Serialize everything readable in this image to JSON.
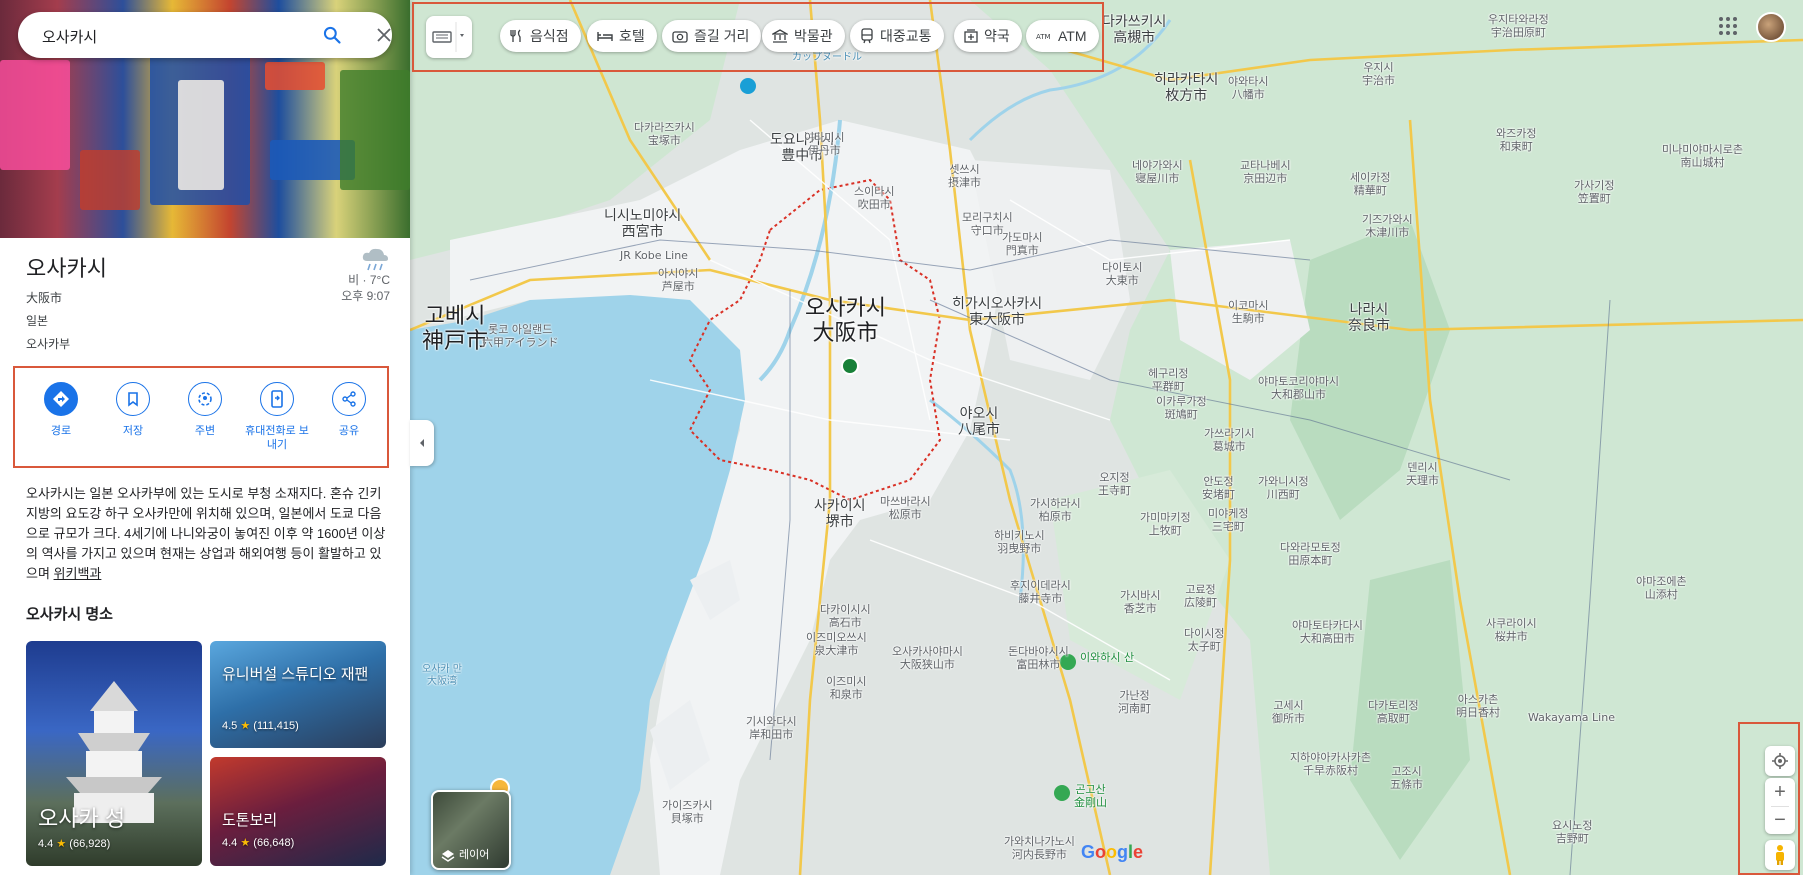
{
  "search": {
    "value": "오사카시"
  },
  "place": {
    "name": "오사카시",
    "local_name": "大阪市",
    "country": "일본",
    "region": "오사카부",
    "weather": {
      "condition": "비 · 7°C",
      "time": "오후 9:07"
    }
  },
  "actions": [
    {
      "label": "경로",
      "icon": "directions-icon"
    },
    {
      "label": "저장",
      "icon": "bookmark-icon"
    },
    {
      "label": "주변",
      "icon": "nearby-icon"
    },
    {
      "label": "휴대전화로 보내기",
      "icon": "send-to-phone-icon"
    },
    {
      "label": "공유",
      "icon": "share-icon"
    }
  ],
  "description": {
    "text": "오사카시는 일본 오사카부에 있는 도시로 부청 소재지다. 혼슈 긴키 지방의 요도강 하구 오사카만에 위치해 있으며, 일본에서 도쿄 다음으로 규모가 크다. 4세기에 나니와궁이 놓여진 이후 약 1600년 이상의 역사를 가지고 있으며 현재는 상업과 해외여행 등이 활발하고 있으며 ",
    "wiki_link": "위키백과"
  },
  "landmarks": {
    "title": "오사카시 명소",
    "items": [
      {
        "name": "오사카 성",
        "rating": "4.4",
        "reviews": "(66,928)"
      },
      {
        "name": "유니버설 스튜디오 재팬",
        "rating": "4.5",
        "reviews": "(111,415)"
      },
      {
        "name": "도톤보리",
        "rating": "4.4",
        "reviews": "(66,648)"
      }
    ]
  },
  "chips": [
    {
      "label": "음식점",
      "icon": "restaurant-icon"
    },
    {
      "label": "호텔",
      "icon": "hotel-icon"
    },
    {
      "label": "즐길 거리",
      "icon": "camera-icon"
    },
    {
      "label": "박물관",
      "icon": "museum-icon"
    },
    {
      "label": "대중교통",
      "icon": "transit-icon"
    },
    {
      "label": "약국",
      "icon": "pharmacy-icon"
    },
    {
      "label": "ATM",
      "icon": "atm-icon"
    }
  ],
  "map_labels": {
    "osaka_ko": "오사카시",
    "osaka_ja": "大阪市",
    "kobe_ko": "고베시",
    "kobe_ja": "神戸市",
    "nishinomiya_ko": "니시노미야시",
    "nishinomiya_ja": "西宮市",
    "toyonaka_ko": "도요나카시",
    "toyonaka_ja": "豊中市",
    "takatsuki_ko": "다카쓰키시",
    "takatsuki_ja": "高槻市",
    "hirakata_ko": "히라카타시",
    "hirakata_ja": "枚方市",
    "higashiosaka_ko": "히가시오사카시",
    "higashiosaka_ja": "東大阪市",
    "yao_ko": "야오시",
    "yao_ja": "八尾市",
    "sakai_ko": "사카이시",
    "sakai_ja": "堺市",
    "nara_ko": "나라시",
    "nara_ja": "奈良市",
    "takarazuka_ko": "다카라즈카시",
    "takarazuka_ja": "宝塚市",
    "itami_ko": "이타미시",
    "itami_ja": "伊丹市",
    "ashiya_ko": "아시야시",
    "ashiya_ja": "芦屋市",
    "rokko_ko": "롯코 아일랜드",
    "rokko_ja": "六甲アイランド",
    "suita_ko": "스이타시",
    "suita_ja": "吹田市",
    "settsu_ko": "셋쓰시",
    "settsu_ja": "摂津市",
    "moriguchi_ko": "모리구치시",
    "moriguchi_ja": "守口市",
    "kadoma_ko": "가도마시",
    "kadoma_ja": "門真市",
    "daito_ko": "다이토시",
    "daito_ja": "大東市",
    "neyagawa_ko": "네야가와시",
    "neyagawa_ja": "寝屋川市",
    "ikoma_ko": "이코마시",
    "ikoma_ja": "生駒市",
    "yamatokoriyama_ko": "야마토코리야마시",
    "yamatokoriyama_ja": "大和郡山市",
    "kashihara_ko": "가시하라시",
    "kashihara_ja": "柏原市",
    "habikino_ko": "하비키노시",
    "habikino_ja": "羽曳野市",
    "matsubara_ko": "마쓰바라시",
    "matsubara_ja": "松原市",
    "takaishi_ko": "다카이시시",
    "takaishi_ja": "高石市",
    "izumiotsu_ko": "이즈미오쓰시",
    "izumiotsu_ja": "泉大津市",
    "izumi_ko": "이즈미시",
    "izumi_ja": "和泉市",
    "kishiwada_ko": "기시와다시",
    "kishiwada_ja": "岸和田市",
    "kaizuka_ko": "가이즈카시",
    "kaizuka_ja": "貝塚市",
    "tondabayashi_ko": "돈다바야시시",
    "tondabayashi_ja": "富田林市",
    "osakasayama_ko": "오사카사야마시",
    "osakasayama_ja": "大阪狭山市",
    "kawachinagano_ko": "가와치나가노시",
    "kawachinagano_ja": "河内長野市",
    "kashiba_ko": "가시바시",
    "kashiba_ja": "香芝市",
    "gojo_ko": "고조시",
    "gojo_ja": "五條市",
    "yoshino_ko": "요시노정",
    "yoshino_ja": "吉野町",
    "sakurai_ko": "사쿠라이시",
    "sakurai_ja": "桜井市",
    "tenri_ko": "덴리시",
    "tenri_ja": "天理市",
    "kizugawa_ko": "기즈가와시",
    "kizugawa_ja": "木津川市",
    "uji_ko": "우지시",
    "uji_ja": "宇治市",
    "ujitawara_ko": "우지타와라정",
    "ujitawara_ja": "宇治田原町",
    "kyotanabe_ko": "교타나베시",
    "kyotanabe_ja": "京田辺市",
    "yawata_ko": "야와타시",
    "yawata_ja": "八幡市",
    "minamiyamashiro_ko": "미나미야마시로촌",
    "minamiyamashiro_ja": "南山城村",
    "wazuka_ko": "와즈카정",
    "wazuka_ja": "和束町",
    "kasagi_ko": "가사기정",
    "kasagi_ja": "笠置町",
    "seika_ko": "세이카정",
    "seika_ja": "精華町",
    "ikaruga_ko": "이카루가정",
    "ikaruga_ja": "斑鳩町",
    "ando_ko": "안도정",
    "ando_ja": "安堵町",
    "tawaramoto_ko": "다와라모토정",
    "tawaramoto_ja": "田原本町",
    "kawanishi_ko": "가와니시정",
    "kawanishi_ja": "川西町",
    "miyake_ko": "미야케정",
    "miyake_ja": "三宅町",
    "kamimaki_ko": "가미마키정",
    "kamimaki_ja": "上牧町",
    "oji_ko": "오지정",
    "oji_ja": "王寺町",
    "koryo_ko": "고료정",
    "koryo_ja": "広陵町",
    "heguri_ko": "헤구리정",
    "heguri_ja": "平群町",
    "yamazoe_ko": "야마조에촌",
    "yamazoe_ja": "山添村",
    "asuka_ko": "아스카촌",
    "asuka_ja": "明日香村",
    "takatori_ko": "다카토리정",
    "takatori_ja": "高取町",
    "katsuragi_ko": "가쓰라기시",
    "katsuragi_ja": "葛城市",
    "gose_ko": "고세시",
    "gose_ja": "御所市",
    "yamatotakada_ko": "야마토타카다시",
    "yamatotakada_ja": "大和高田市",
    "fujiidera_ko": "후지이데라시",
    "fujiidera_ja": "藤井寺市",
    "kanan_ko": "가난정",
    "kanan_ja": "河南町",
    "taishi_ko": "다이시정",
    "taishi_ja": "太子町",
    "chihayaakasaka_ko": "지하야아카사카촌",
    "chihayaakasaka_ja": "千早赤阪村",
    "mt_iwahashi_ko": "이와하시 산",
    "mt_kongo_ko": "곤고산",
    "mt_kongo_ja": "金剛山",
    "osaka_bay_ko": "오사카 만",
    "osaka_bay_ja": "大阪湾",
    "cupnoodle": "カップヌードル",
    "jr_kobe_line": "JR Kobe Line",
    "wakayama_line": "Wakayama Line"
  },
  "map_controls": {
    "layer_label": "레이어",
    "zoom_in": "+",
    "zoom_out": "−"
  },
  "colors": {
    "accent": "#1a73e8",
    "highlight_border": "#d9583b",
    "water": "#9fd3ea",
    "urban": "#f1f3f4",
    "green": "#cfe8d2"
  },
  "logo": "Google"
}
